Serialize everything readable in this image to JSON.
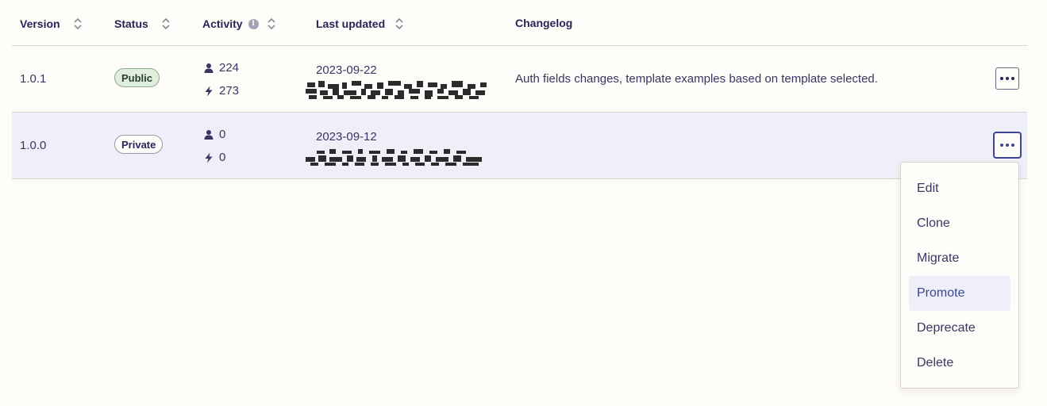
{
  "table": {
    "headers": {
      "version": "Version",
      "status": "Status",
      "activity": "Activity",
      "last_updated": "Last updated",
      "changelog": "Changelog"
    },
    "rows": [
      {
        "version": "1.0.1",
        "status": "Public",
        "users": "224",
        "zaps": "273",
        "date": "2023-09-22",
        "changelog": "Auth fields changes, template examples based on template selected."
      },
      {
        "version": "1.0.0",
        "status": "Private",
        "users": "0",
        "zaps": "0",
        "date": "2023-09-12",
        "changelog": ""
      }
    ]
  },
  "menu": {
    "items": [
      "Edit",
      "Clone",
      "Migrate",
      "Promote",
      "Deprecate",
      "Delete"
    ],
    "highlighted": "Promote"
  },
  "icons": {
    "sort": "sort-icon",
    "info": "info-icon",
    "user": "user-icon",
    "bolt": "bolt-icon",
    "more": "more-horizontal-icon"
  },
  "colors": {
    "background": "#fffdf9",
    "selected_row": "#eeeff8",
    "accent": "#3d4592",
    "public_badge_bg": "#dfeedd"
  }
}
